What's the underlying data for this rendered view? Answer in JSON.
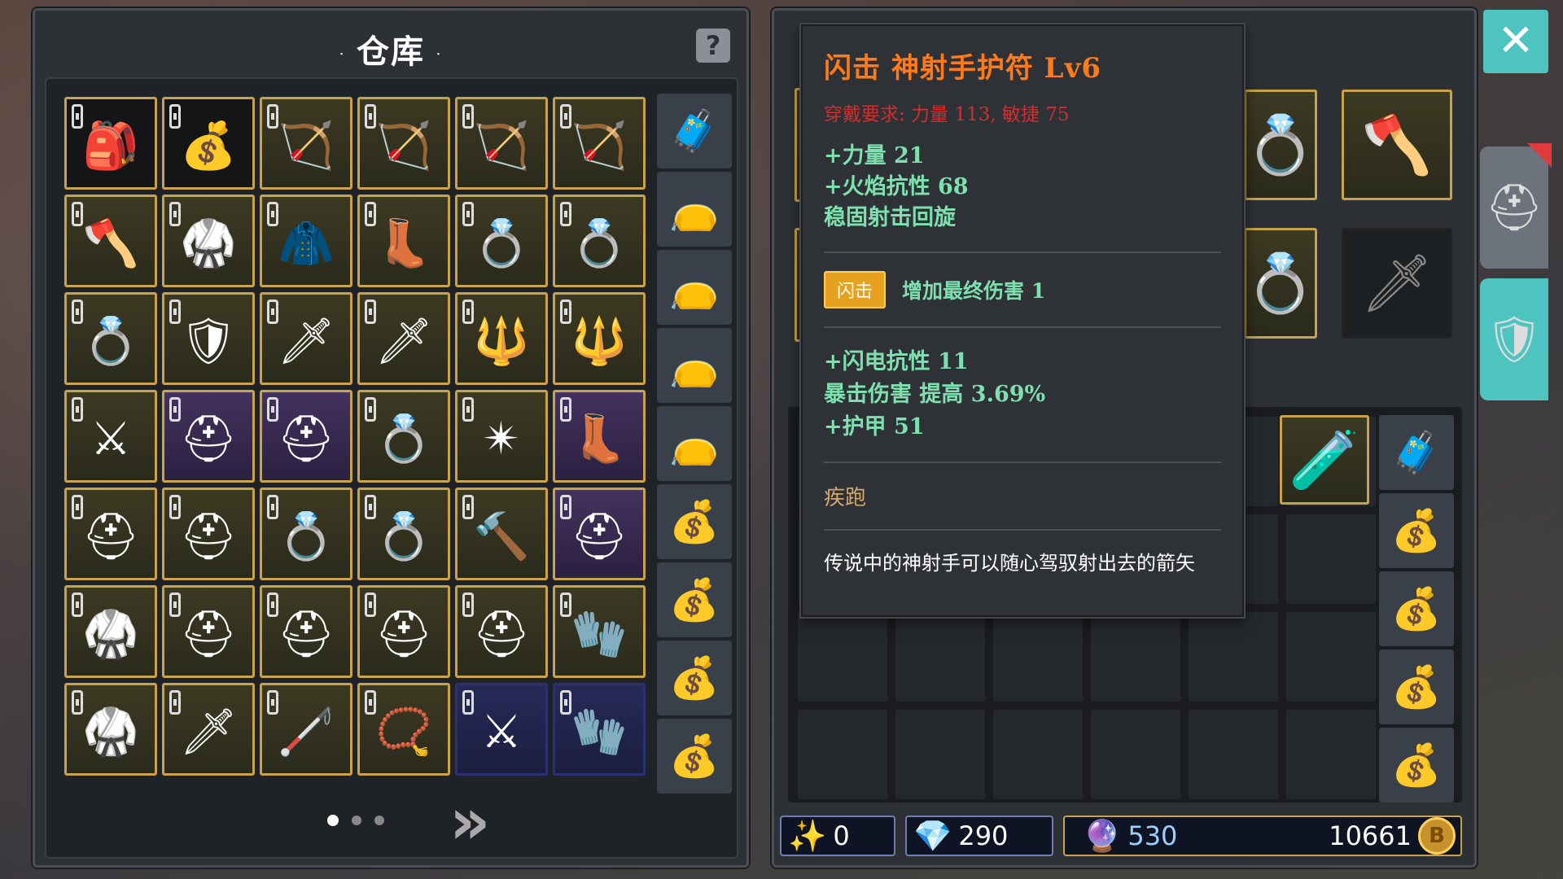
{
  "warehouse": {
    "title": "仓库",
    "title_decor": "·",
    "help_label": "?",
    "slots": [
      [
        "brown-sack",
        "black",
        "🎒"
      ],
      [
        "coin-pouch",
        "black",
        "💰"
      ],
      [
        "purple-bow",
        "gold",
        "🏹"
      ],
      [
        "spiked-bow",
        "gold",
        "🏹"
      ],
      [
        "spiked-bow-2",
        "gold",
        "🏹"
      ],
      [
        "thorn-bow",
        "gold",
        "🏹"
      ],
      [
        "battle-axe",
        "gold",
        "🪓"
      ],
      [
        "dark-robe",
        "gold",
        "🥋"
      ],
      [
        "red-cloak",
        "gold",
        "🧥"
      ],
      [
        "leather-boots",
        "gold",
        "👢"
      ],
      [
        "frost-ring",
        "gold",
        "💍"
      ],
      [
        "frost-ring-2",
        "gold",
        "💍"
      ],
      [
        "red-ring",
        "gold",
        "💍"
      ],
      [
        "dark-armor",
        "gold",
        "🛡"
      ],
      [
        "purple-dagger",
        "gold",
        "🗡"
      ],
      [
        "purple-dagger-2",
        "gold",
        "🗡"
      ],
      [
        "red-spear",
        "gold",
        "🔱"
      ],
      [
        "red-spear-2",
        "gold",
        "🔱"
      ],
      [
        "dark-sword",
        "gold",
        "⚔"
      ],
      [
        "purple-helm",
        "purple",
        "⛑"
      ],
      [
        "purple-helm-2",
        "purple",
        "⛑"
      ],
      [
        "ruby-ring",
        "gold",
        "💍"
      ],
      [
        "gold-amulet",
        "gold",
        "✴"
      ],
      [
        "white-boots",
        "purple",
        "👢"
      ],
      [
        "iron-helm",
        "gold",
        "⛑"
      ],
      [
        "red-helm",
        "gold",
        "⛑"
      ],
      [
        "sapphire-ring",
        "gold",
        "💍"
      ],
      [
        "topaz-ring",
        "gold",
        "💍"
      ],
      [
        "spiked-mace",
        "gold",
        "🔨"
      ],
      [
        "hooded-helm",
        "purple",
        "⛑"
      ],
      [
        "leather-armor",
        "gold",
        "🥋"
      ],
      [
        "great-helm",
        "gold",
        "⛑"
      ],
      [
        "great-helm-2",
        "gold",
        "⛑"
      ],
      [
        "great-helm-3",
        "gold",
        "⛑"
      ],
      [
        "great-helm-4",
        "gold",
        "⛑"
      ],
      [
        "iron-gauntlet",
        "gold",
        "🧤"
      ],
      [
        "red-armor",
        "gold",
        "🥋"
      ],
      [
        "black-sword",
        "gold",
        "🗡"
      ],
      [
        "wood-staff",
        "gold",
        "🦯"
      ],
      [
        "gold-necklace",
        "gold",
        "📿"
      ],
      [
        "crossed-blades",
        "blue",
        "⚔"
      ],
      [
        "steel-gauntlet",
        "blue",
        "🧤"
      ]
    ],
    "side": [
      "🧳",
      "👝",
      "👝",
      "👝",
      "👝",
      "💰",
      "💰",
      "💰",
      "💰"
    ],
    "page_next": "»"
  },
  "tooltip": {
    "title": "闪击 神射手护符 Lv6",
    "requirement": "穿戴要求:  力量 113, 敏捷 75",
    "stats_1": [
      "+力量 21",
      "+火焰抗性 68",
      "稳固射击回旋"
    ],
    "skill_badge": "闪击",
    "skill_text": "增加最终伤害 1",
    "stats_2": [
      "+闪电抗性 11",
      "暴击伤害 提高 3.69%",
      "+护甲 51"
    ],
    "suffix": "疾跑",
    "lore": "传说中的神射手可以随心驾驭射出去的箭矢"
  },
  "equipment": {
    "slot_icons": [
      "💍",
      "🪓",
      "💍",
      "🗡"
    ]
  },
  "bag": {
    "top_items": [
      "🧪"
    ],
    "side": [
      "🧳",
      "💰",
      "💰",
      "💰",
      "💰"
    ]
  },
  "currencies": {
    "shards": "0",
    "crystals": "290",
    "gems": "530",
    "gold": "10661",
    "gold_symbol": "B"
  },
  "colors": {
    "accent": "#4ec4c0",
    "gold_border": "#c9a34a",
    "title_orange": "#ff7a1a",
    "stat_green": "#7ee0ae",
    "req_red": "#d12e2e"
  },
  "buttons": {
    "close": "✕",
    "helm_tab": "⛑",
    "armor_tab": "🛡"
  }
}
